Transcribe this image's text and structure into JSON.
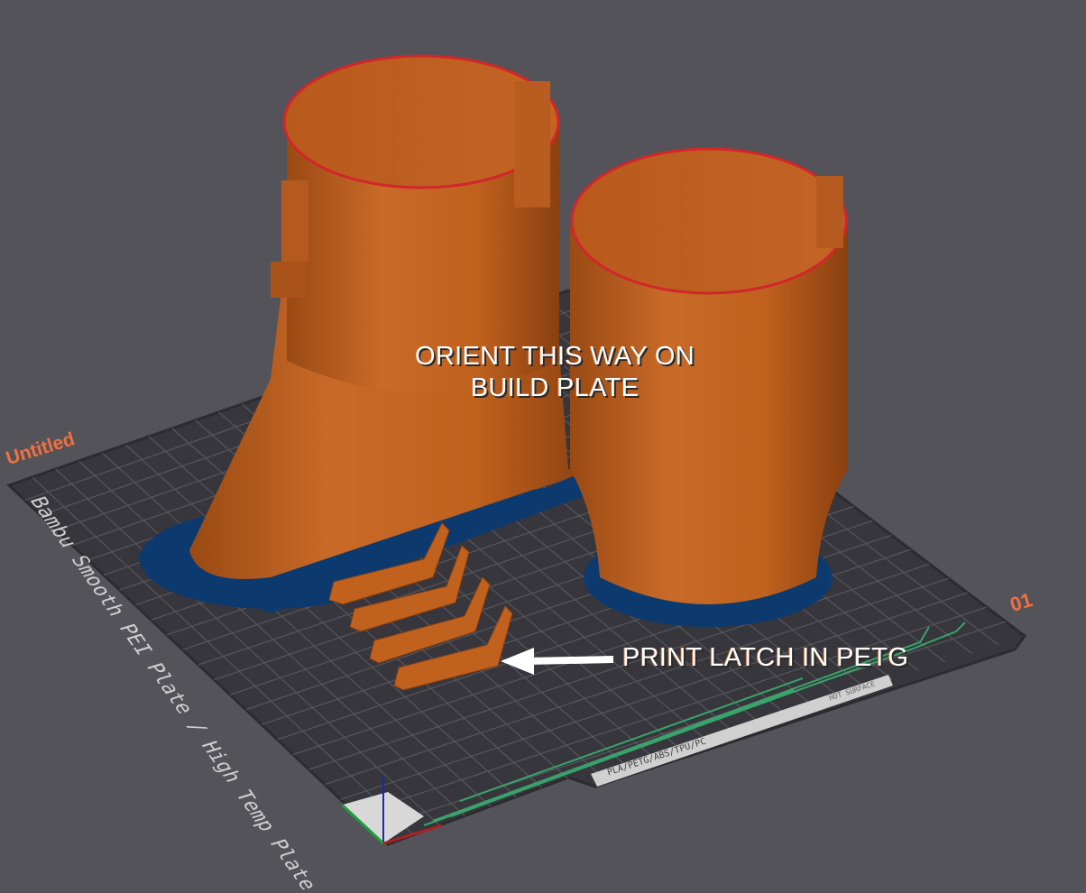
{
  "viewport": {
    "project_name": "Untitled",
    "plate_number": "01",
    "plate_type": "Bambu Smooth PEI Plate / High Temp Plate",
    "plate_filament_label": "PLA/PETG/ABS/TPU/PC",
    "plate_warning_label": "HOT SURFACE"
  },
  "annotations": {
    "orient_line1": "ORIENT THIS WAY ON",
    "orient_line2": "BUILD PLATE",
    "latch_note": "PRINT LATCH IN PETG"
  },
  "colors": {
    "background": "#545359",
    "plate": "#36363c",
    "model": "#c0611e",
    "brim": "#0d3a6e",
    "accent": "#f07040",
    "plate_lines": "#3aa36b"
  }
}
